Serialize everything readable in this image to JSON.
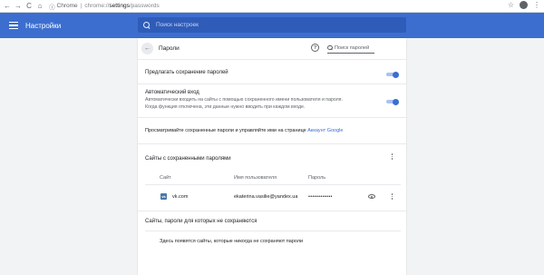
{
  "browser": {
    "back_glyph": "←",
    "forward_glyph": "→",
    "reload_glyph": "C",
    "home_glyph": "⌂",
    "secure_glyph": "ⓘ",
    "scheme": "Chrome",
    "separator": "|",
    "url_host": "chrome://",
    "url_settings": "settings",
    "url_tail": "/passwords",
    "star_glyph": "☆",
    "menu_glyph": "⋮"
  },
  "header": {
    "title": "Настройки",
    "search_placeholder": "Поиск настроек"
  },
  "page": {
    "back_glyph": "←",
    "title": "Пароли",
    "help_glyph": "?",
    "search_placeholder": "Поиск паролей"
  },
  "settings": {
    "offer_save": "Предлагать сохранение паролей",
    "auto_signin_title": "Автоматический вход",
    "auto_signin_desc_1": "Автоматически входить на сайты с помощью сохраненного имени пользователя и пароля.",
    "auto_signin_desc_2": "Когда функция отключена, эти данные нужно вводить при каждом входе.",
    "manage_text": "Просматривайте сохраненные пароли и управляйте ими на странице",
    "manage_link": "Аккаунт Google"
  },
  "saved": {
    "section_title": "Сайты с сохраненными паролями",
    "col_site": "Сайт",
    "col_user": "Имя пользователя",
    "col_password": "Пароль",
    "rows": [
      {
        "favicon": "vk",
        "site": "vk.com",
        "user": "ekaterina.vasilie@yandex.ua",
        "password": "••••••••••••"
      }
    ]
  },
  "never": {
    "section_title": "Сайты, пароли для которых не сохраняются",
    "empty_text": "Здесь появятся сайты, которые никогда не сохраняют пароли"
  },
  "colors": {
    "accent": "#3c6ed0",
    "toggle_track": "#a8c2f0"
  }
}
